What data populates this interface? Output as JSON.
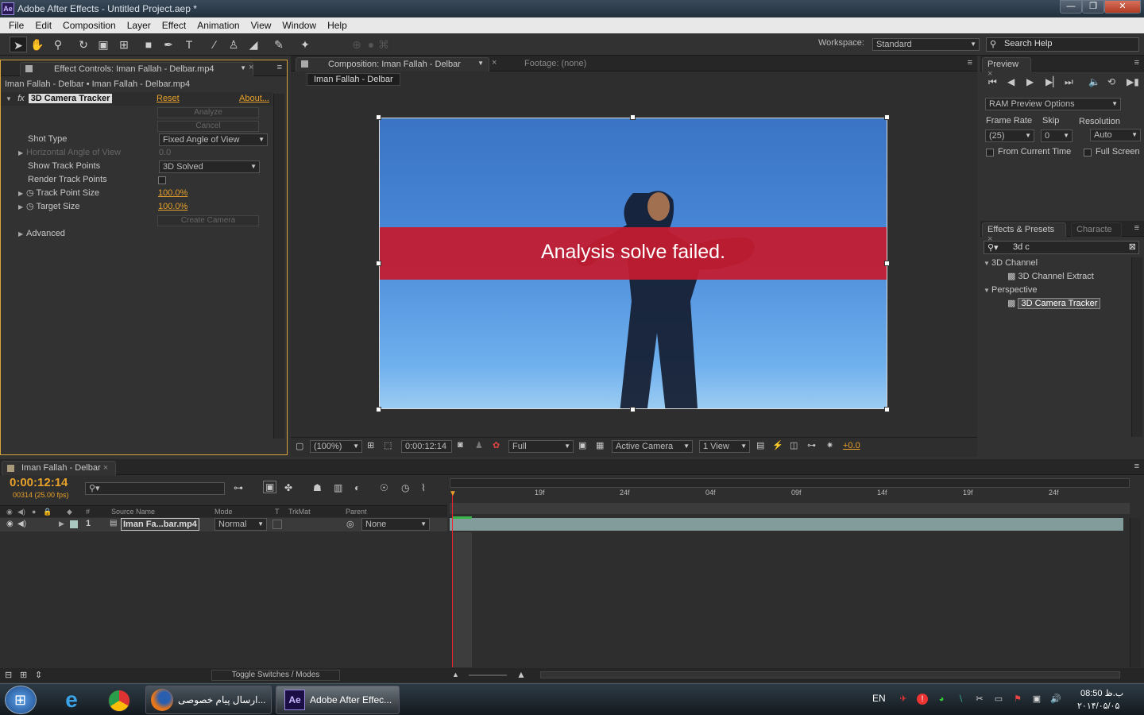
{
  "window": {
    "title": "Adobe After Effects - Untitled Project.aep *",
    "app_icon": "Ae",
    "min": "—",
    "max": "❐",
    "close": "✕"
  },
  "menu": [
    "File",
    "Edit",
    "Composition",
    "Layer",
    "Effect",
    "Animation",
    "View",
    "Window",
    "Help"
  ],
  "workspace": {
    "label": "Workspace:",
    "value": "Standard"
  },
  "search_help": {
    "placeholder": "Search Help"
  },
  "effect_controls": {
    "tab_label": "Effect Controls: Iman Fallah - Delbar.mp4",
    "breadcrumb": "Iman Fallah - Delbar • Iman Fallah - Delbar.mp4",
    "effect_name": "3D Camera Tracker",
    "fx": "fx",
    "reset": "Reset",
    "about": "About...",
    "analyze": "Analyze",
    "cancel": "Cancel",
    "shot_type_label": "Shot Type",
    "shot_type_value": "Fixed Angle of View",
    "horizontal_angle_label": "Horizontal Angle of View",
    "horizontal_angle_value": "0.0",
    "show_track_points_label": "Show Track Points",
    "show_track_points_value": "3D Solved",
    "render_track_points_label": "Render Track Points",
    "track_point_size_label": "Track Point Size",
    "track_point_size_value": "100.0%",
    "target_size_label": "Target Size",
    "target_size_value": "100.0%",
    "create_camera": "Create Camera",
    "advanced_label": "Advanced"
  },
  "composition": {
    "tab_label": "Composition: Iman Fallah - Delbar",
    "footage_tab": "Footage: (none)",
    "comp_button": "Iman Fallah - Delbar",
    "message": "Analysis solve failed.",
    "zoom": "(100%)",
    "timecode": "0:00:12:14",
    "resolution": "Full",
    "camera": "Active Camera",
    "views": "1 View",
    "exposure": "+0.0"
  },
  "preview": {
    "tab_label": "Preview",
    "options": "RAM Preview Options",
    "frame_rate_label": "Frame Rate",
    "skip_label": "Skip",
    "resolution_label": "Resolution",
    "frame_rate_value": "(25)",
    "skip_value": "0",
    "resolution_value": "Auto",
    "from_current_time": "From Current Time",
    "full_screen": "Full Screen"
  },
  "effects_presets": {
    "tab_label": "Effects & Presets",
    "tab2_label": "Characte",
    "search_value": "3d c",
    "groups": [
      {
        "name": "3D Channel",
        "items": [
          "3D Channel Extract"
        ]
      },
      {
        "name": "Perspective",
        "items": [
          "3D Camera Tracker"
        ]
      }
    ]
  },
  "timeline": {
    "tab_label": "Iman Fallah - Delbar",
    "timecode": "0:00:12:14",
    "frames": "00314 (25.00 fps)",
    "columns": {
      "num": "#",
      "source": "Source Name",
      "mode": "Mode",
      "t": "T",
      "trkmat": "TrkMat",
      "parent": "Parent"
    },
    "layer": {
      "num": "1",
      "name": "Iman Fa...bar.mp4",
      "mode": "Normal",
      "parent": "None"
    },
    "ruler": [
      "19f",
      "24f",
      "04f",
      "09f",
      "14f",
      "19f",
      "24f"
    ],
    "toggle": "Toggle Switches / Modes"
  },
  "taskbar": {
    "task1": "ارسال پیام خصوصی...",
    "task2": "Adobe After Effec...",
    "lang": "EN",
    "time": "08:50 ب.ظ",
    "date": "۲۰۱۴/۰۵/۰۵"
  },
  "colors": {
    "accent": "#e8a12a",
    "alert": "#c41c30",
    "layer_bar": "#9fc2c0"
  }
}
